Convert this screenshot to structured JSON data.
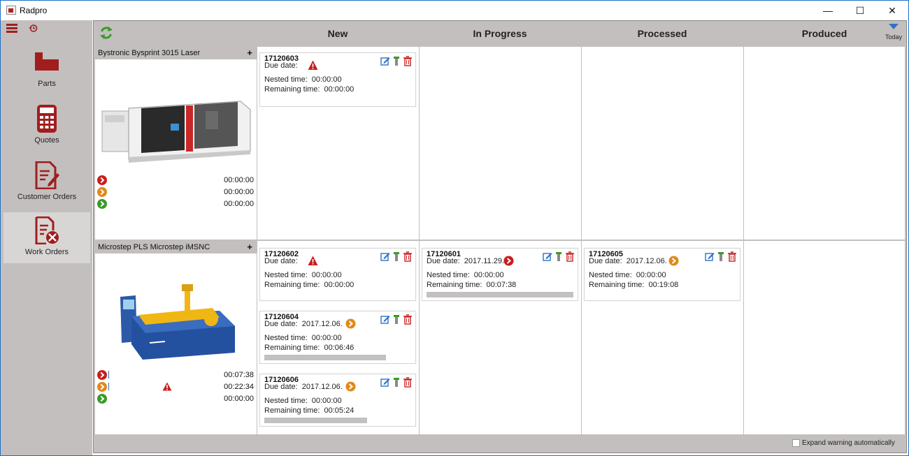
{
  "window": {
    "title": "Radpro",
    "minimize_glyph": "—",
    "maximize_glyph": "☐",
    "close_glyph": "✕"
  },
  "sidebar": {
    "items": [
      {
        "label": "Parts",
        "icon": "parts-icon"
      },
      {
        "label": "Quotes",
        "icon": "calculator-icon"
      },
      {
        "label": "Customer Orders",
        "icon": "document-edit-icon"
      },
      {
        "label": "Work Orders",
        "icon": "work-orders-icon"
      }
    ],
    "active": "Work Orders"
  },
  "board": {
    "columns": [
      "New",
      "In Progress",
      "Processed",
      "Produced"
    ],
    "today_label": "Today",
    "expand_label": "Expand warning automatically",
    "expand_checked": false
  },
  "colors": {
    "brand_red": "#a01e1e",
    "late_red": "#c81e1e",
    "warning_orange": "#e08a1a",
    "ok_green": "#3a9a2a",
    "edit_blue": "#2c72c8",
    "panel_gray": "#c3bfbe"
  },
  "machines": [
    {
      "name": "Bystronic Bysprint 3015 Laser",
      "plus": "+",
      "stats": [
        {
          "status": "late",
          "time": "00:00:00",
          "warning": false
        },
        {
          "status": "warning",
          "time": "00:00:00",
          "warning": false
        },
        {
          "status": "ok",
          "time": "00:00:00",
          "warning": false
        }
      ]
    },
    {
      "name": "Microstep PLS Microstep iMSNC",
      "plus": "+",
      "stats": [
        {
          "status": "late",
          "time": "00:07:38",
          "warning": false
        },
        {
          "status": "warning",
          "time": "00:22:34",
          "warning": true
        },
        {
          "status": "ok",
          "time": "00:00:00",
          "warning": false
        }
      ]
    }
  ],
  "cards": [
    {
      "id": "17120603",
      "machine": 0,
      "column": "New",
      "due_label": "Due date:",
      "due_date": "",
      "due_status": "warning-triangle",
      "nested_label": "Nested time:",
      "nested_time": "00:00:00",
      "remaining_label": "Remaining time:",
      "remaining_time": "00:00:00",
      "progress": null
    },
    {
      "id": "17120602",
      "machine": 1,
      "column": "New",
      "due_label": "Due date:",
      "due_date": "",
      "due_status": "warning-triangle",
      "nested_label": "Nested time:",
      "nested_time": "00:00:00",
      "remaining_label": "Remaining time:",
      "remaining_time": "00:00:00",
      "progress": null
    },
    {
      "id": "17120604",
      "machine": 1,
      "column": "New",
      "due_label": "Due date:",
      "due_date": "2017.12.06.",
      "due_status": "orange",
      "nested_label": "Nested time:",
      "nested_time": "00:00:00",
      "remaining_label": "Remaining time:",
      "remaining_time": "00:06:46",
      "progress": 0.83
    },
    {
      "id": "17120606",
      "machine": 1,
      "column": "New",
      "due_label": "Due date:",
      "due_date": "2017.12.06.",
      "due_status": "orange",
      "nested_label": "Nested time:",
      "nested_time": "00:00:00",
      "remaining_label": "Remaining time:",
      "remaining_time": "00:05:24",
      "progress": 0.7
    },
    {
      "id": "17120601",
      "machine": 1,
      "column": "In Progress",
      "due_label": "Due date:",
      "due_date": "2017.11.29.",
      "due_status": "red",
      "nested_label": "Nested time:",
      "nested_time": "00:00:00",
      "remaining_label": "Remaining time:",
      "remaining_time": "00:07:38",
      "progress": 1.0
    },
    {
      "id": "17120605",
      "machine": 1,
      "column": "Processed",
      "due_label": "Due date:",
      "due_date": "2017.12.06.",
      "due_status": "orange",
      "nested_label": "Nested time:",
      "nested_time": "00:00:00",
      "remaining_label": "Remaining time:",
      "remaining_time": "00:19:08",
      "progress": null
    }
  ]
}
